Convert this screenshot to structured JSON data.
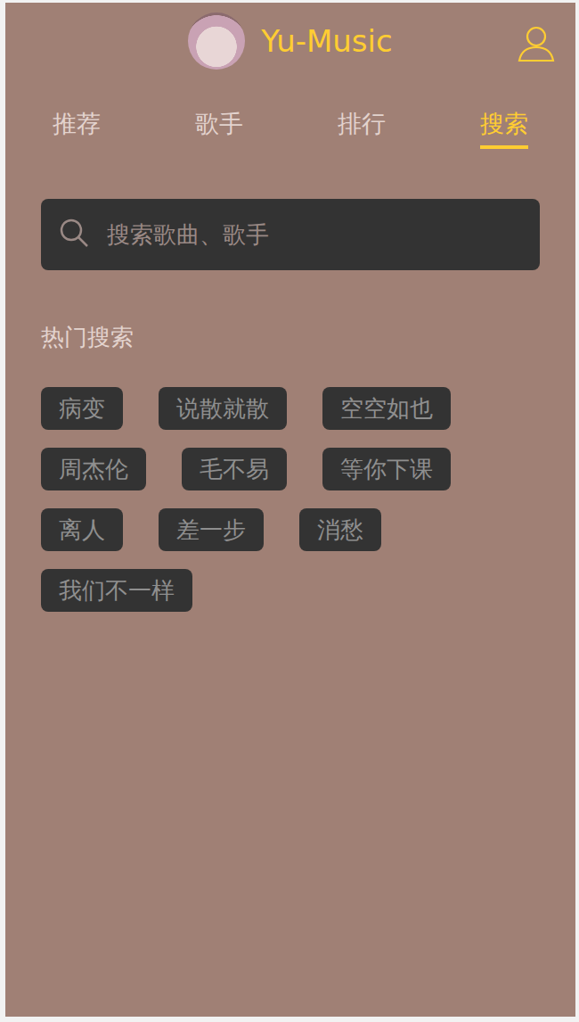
{
  "header": {
    "title": "Yu-Music"
  },
  "tabs": [
    {
      "label": "推荐",
      "selected": false
    },
    {
      "label": "歌手",
      "selected": false
    },
    {
      "label": "排行",
      "selected": false
    },
    {
      "label": "搜索",
      "selected": true
    }
  ],
  "search": {
    "placeholder": "搜索歌曲、歌手"
  },
  "hot": {
    "title": "热门搜索",
    "tags": [
      "病变",
      "说散就散",
      "空空如也",
      "周杰伦",
      "毛不易",
      "等你下课",
      "离人",
      "差一步",
      "消愁",
      "我们不一样"
    ]
  }
}
